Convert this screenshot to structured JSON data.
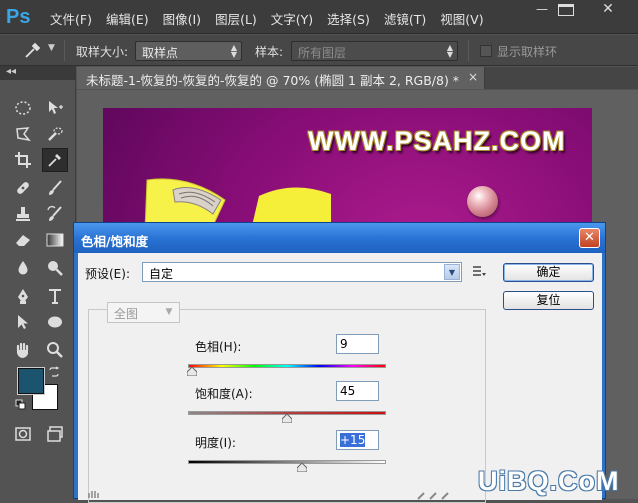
{
  "app": {
    "logo": "Ps",
    "menu": [
      "文件(F)",
      "编辑(E)",
      "图像(I)",
      "图层(L)",
      "文字(Y)",
      "选择(S)",
      "滤镜(T)",
      "视图(V)"
    ],
    "window_controls": {
      "minimize": "—",
      "close": "✕"
    }
  },
  "options_bar": {
    "sample_size_label": "取样大小:",
    "sample_size_value": "取样点",
    "sample_label": "样本:",
    "sample_value": "所有图层",
    "show_ring_label": "显示取样环"
  },
  "toolbox": {
    "collapse_glyph": "◂◂",
    "foreground_color": "#1c5470",
    "background_color": "#ffffff"
  },
  "document": {
    "tab_title": "未标题-1-恢复的-恢复的-恢复的 @ 70% (椭圆 1 副本 2, RGB/8) *",
    "tab_close": "×",
    "canvas_text": "WWW.PSAHZ.COM"
  },
  "watermark": "UiBQ.CoM",
  "dialog": {
    "title": "色相/饱和度",
    "close_glyph": "✕",
    "preset_label": "预设(E):",
    "preset_value": "自定",
    "ok_button": "确定",
    "reset_button": "复位",
    "channel_value": "全图",
    "hue_label": "色相(H):",
    "hue_value": "9",
    "saturation_label": "饱和度(A):",
    "saturation_value": "45",
    "lightness_label": "明度(I):",
    "lightness_value": "+15",
    "hue_slider_pos": 0.02,
    "saturation_slider_pos": 0.5,
    "lightness_slider_pos": 0.575
  }
}
